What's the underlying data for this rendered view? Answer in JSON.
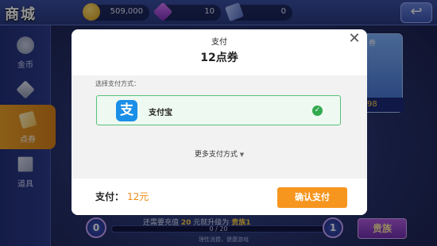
{
  "shop": {
    "title": "商城",
    "resources": {
      "gold": "509,000",
      "gems": "10",
      "tickets": "0"
    },
    "back_icon": "back-arrow-icon",
    "sidebar": [
      {
        "label": "金币",
        "icon": "coin-icon"
      },
      {
        "label": "钻石",
        "icon": "diamond-icon"
      },
      {
        "label": "点券",
        "icon": "ticket-icon",
        "active": true
      },
      {
        "label": "道具",
        "icon": "prop-box-icon"
      }
    ],
    "bg_card": {
      "label": "券",
      "price": "98"
    },
    "vip": {
      "notice_prefix": "还需要充值",
      "notice_amount": "20",
      "notice_middle": "元就升级为",
      "notice_rank": "贵族1",
      "progress_text": "0 / 20",
      "progress": 0,
      "sub_text": "理性消费，健康游戏",
      "current_level": "0",
      "next_level": "1",
      "noble_button": "贵族"
    }
  },
  "modal": {
    "title": "支付",
    "product": "12点券",
    "close_icon": "close-icon",
    "method_prompt": "选择支付方式：",
    "selected_method": {
      "name": "支付宝",
      "logo_glyph": "支",
      "logo_color": "#1A8FE8",
      "selected": true
    },
    "more_methods": "更多支付方式",
    "more_icon": "chevron-down-icon",
    "total_label": "支付：",
    "total_value": "12元",
    "confirm_button": "确认支付",
    "accent_color": "#F6961F",
    "selected_border_color": "#59C07A"
  }
}
